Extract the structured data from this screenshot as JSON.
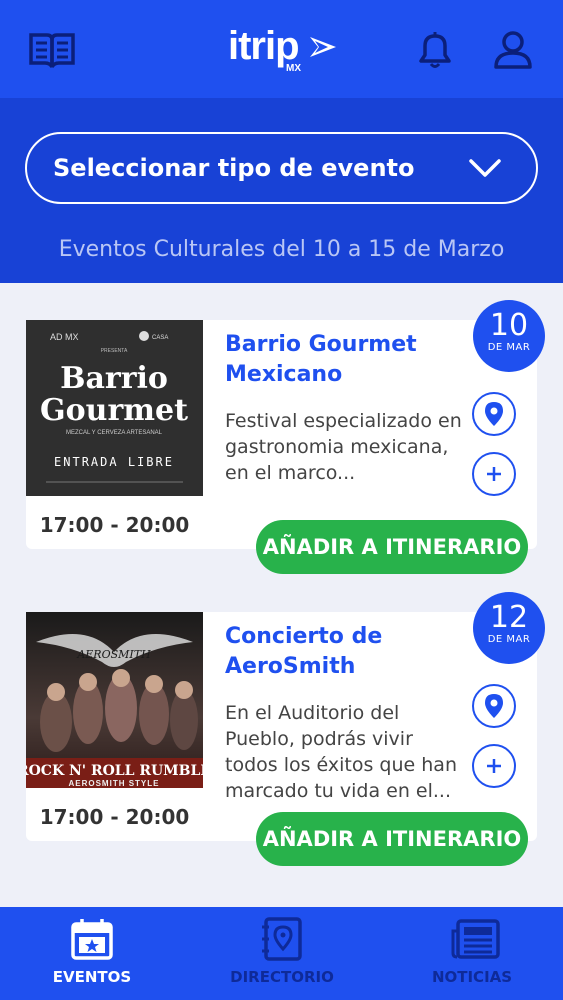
{
  "header": {
    "logo_text": "itrip",
    "logo_sub": "MX",
    "icons": [
      "book-icon",
      "bell-icon",
      "user-icon"
    ]
  },
  "filter": {
    "select_label": "Seleccionar tipo de evento",
    "range_text": "Eventos Culturales del 10 a 15 de Marzo"
  },
  "events": [
    {
      "title": "Barrio Gourmet Mexicano",
      "description": "Festival especializado en gastronomia mexicana, en el marco...",
      "time": "17:00 - 20:00",
      "day": "10",
      "month": "DE MAR",
      "add_label": "AÑADIR A ITINERARIO",
      "poster": {
        "top_left": "AD MX",
        "top_right": "CASA",
        "presents": "PRESENTA",
        "line1": "Barrio",
        "line2": "Gourmet",
        "sub": "MEZCAL Y CERVEZA ARTESANAL",
        "footer": "ENTRADA LIBRE"
      }
    },
    {
      "title": "Concierto de AeroSmith",
      "description": "En el Auditorio del Pueblo, podrás vivir todos los éxitos que han marcado tu vida en el...",
      "time": "17:00 - 20:00",
      "day": "12",
      "month": "DE MAR",
      "add_label": "AÑADIR A ITINERARIO",
      "poster": {
        "logo": "AEROSMITH",
        "line1": "ROCK N' ROLL RUMBLE",
        "line2": "AEROSMITH STYLE"
      }
    }
  ],
  "bottom_nav": [
    {
      "label": "EVENTOS",
      "icon": "calendar-star-icon",
      "active": true
    },
    {
      "label": "DIRECTORIO",
      "icon": "directory-pin-icon",
      "active": false
    },
    {
      "label": "NOTICIAS",
      "icon": "newspaper-icon",
      "active": false
    }
  ],
  "colors": {
    "primary": "#1f50ef",
    "filter_bg": "#1842d6",
    "accent_green": "#28b24b",
    "page_bg": "#eef0f8"
  }
}
